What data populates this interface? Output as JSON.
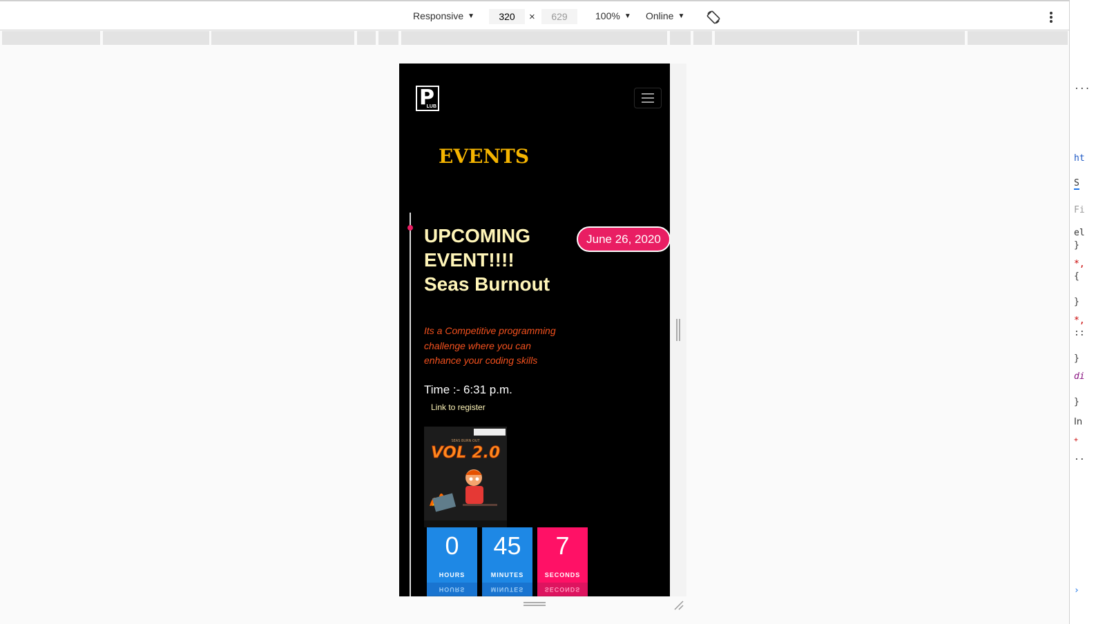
{
  "toolbar": {
    "device": "Responsive",
    "width": "320",
    "height": "629",
    "zoom": "100%",
    "network": "Online",
    "times": "×"
  },
  "site": {
    "logo_letter": "P",
    "logo_sub": "LUB",
    "section_title": "EVENTS"
  },
  "event": {
    "heading": "UPCOMING EVENT!!!! Seas Burnout",
    "date": "June 26, 2020",
    "description": "Its a Competitive programming challenge where you can enhance your coding skills",
    "time": "Time :- 6:31 p.m.",
    "register_link": "Link to register",
    "poster_title": "VOL 2.0",
    "poster_sub": "SEAS BURN OUT"
  },
  "countdown": {
    "hours": {
      "value": "0",
      "label": "HOURS"
    },
    "minutes": {
      "value": "45",
      "label": "MINUTES"
    },
    "seconds": {
      "value": "7",
      "label": "SECONDS"
    }
  },
  "colors": {
    "accent_title": "#f5b400",
    "heading": "#fff5b8",
    "badge": "#e91e63",
    "description": "#f4511e",
    "blue_box": "#1e88e5",
    "pink_box": "#ff1166"
  },
  "right_panel": {
    "lines": [
      "...",
      "ht",
      "S",
      "Fi",
      "el",
      "}",
      "*,",
      "{",
      "}",
      "*,",
      "::",
      "}",
      "di",
      "}",
      "In",
      "+",
      "..",
      "›"
    ]
  }
}
